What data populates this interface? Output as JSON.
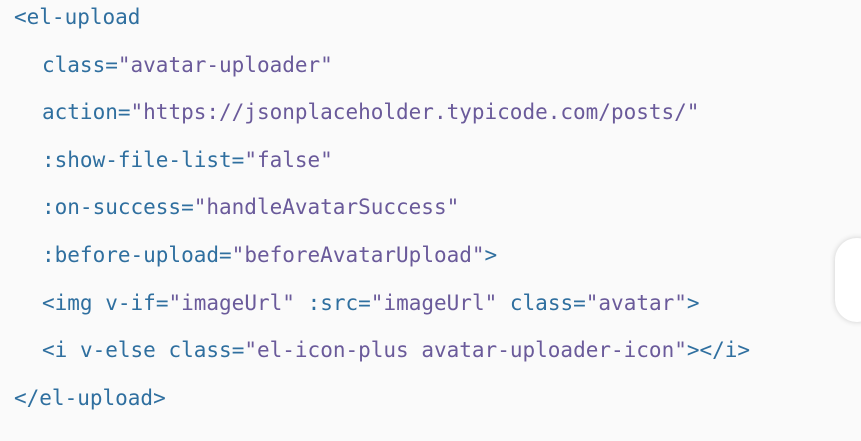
{
  "code": {
    "line1": {
      "tag_open": "<el-upload"
    },
    "line2": {
      "attr": "class",
      "eq": "=",
      "value": "\"avatar-uploader\""
    },
    "line3": {
      "attr": "action",
      "eq": "=",
      "value": "\"https://jsonplaceholder.typicode.com/posts/\""
    },
    "line4": {
      "attr": ":show-file-list",
      "eq": "=",
      "value": "\"false\""
    },
    "line5": {
      "attr": ":on-success",
      "eq": "=",
      "value": "\"handleAvatarSuccess\""
    },
    "line6": {
      "attr": ":before-upload",
      "eq": "=",
      "value": "\"beforeAvatarUpload\"",
      "close": ">"
    },
    "line7": {
      "tag_open": "<img",
      "a1": "v-if",
      "v1": "\"imageUrl\"",
      "a2": ":src",
      "v2": "\"imageUrl\"",
      "a3": "class",
      "v3": "\"avatar\"",
      "close": ">",
      "eq": "="
    },
    "line8": {
      "tag_open": "<i",
      "a1": "v-else",
      "a2": "class",
      "v2": "\"el-icon-plus avatar-uploader-icon\"",
      "close": "></i>",
      "eq": "="
    },
    "line9": {
      "tag_close": "</el-upload>"
    }
  }
}
